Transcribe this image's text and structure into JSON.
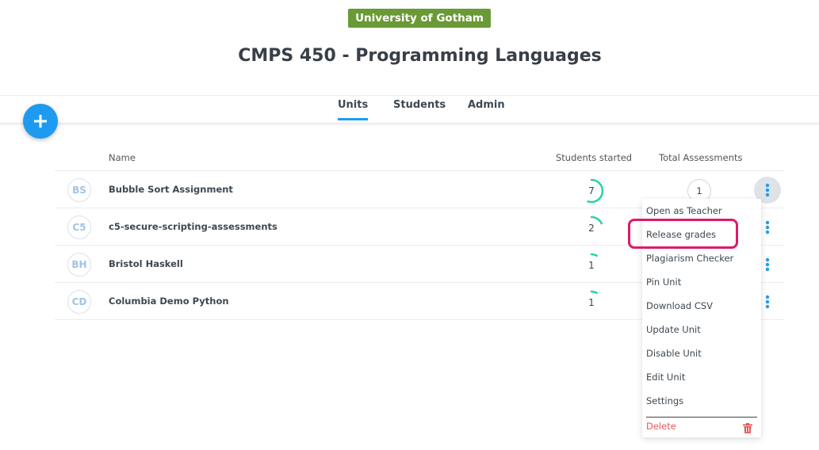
{
  "header": {
    "institution": "University of Gotham",
    "course_title": "CMPS 450 - Programming Languages"
  },
  "tabs": [
    {
      "label": "Units",
      "active": true
    },
    {
      "label": "Students",
      "active": false
    },
    {
      "label": "Admin",
      "active": false
    }
  ],
  "fab": {
    "icon": "plus-icon"
  },
  "table": {
    "columns": {
      "name": "Name",
      "started": "Students started",
      "total": "Total Assessments"
    },
    "rows": [
      {
        "initials": "BS",
        "name": "Bubble Sort Assignment",
        "started": "7",
        "total": "1",
        "progress": 0.55,
        "menu_open": true
      },
      {
        "initials": "C5",
        "name": "c5-secure-scripting-assessments",
        "started": "2",
        "total": "",
        "progress": 0.18,
        "menu_open": false
      },
      {
        "initials": "BH",
        "name": "Bristol Haskell",
        "started": "1",
        "total": "",
        "progress": 0.08,
        "menu_open": false
      },
      {
        "initials": "CD",
        "name": "Columbia Demo Python",
        "started": "1",
        "total": "",
        "progress": 0.08,
        "menu_open": false
      }
    ]
  },
  "context_menu": {
    "items": [
      "Open as Teacher",
      "Release grades",
      "Plagiarism Checker",
      "Pin Unit",
      "Download CSV",
      "Update Unit",
      "Disable Unit",
      "Edit Unit",
      "Settings"
    ],
    "delete_label": "Delete",
    "highlighted_item": "Release grades"
  },
  "colors": {
    "badge": "#6a9a36",
    "accent": "#1e9bf0",
    "progress": "#26d3a4",
    "highlight": "#e0196a",
    "danger": "#e35959"
  }
}
